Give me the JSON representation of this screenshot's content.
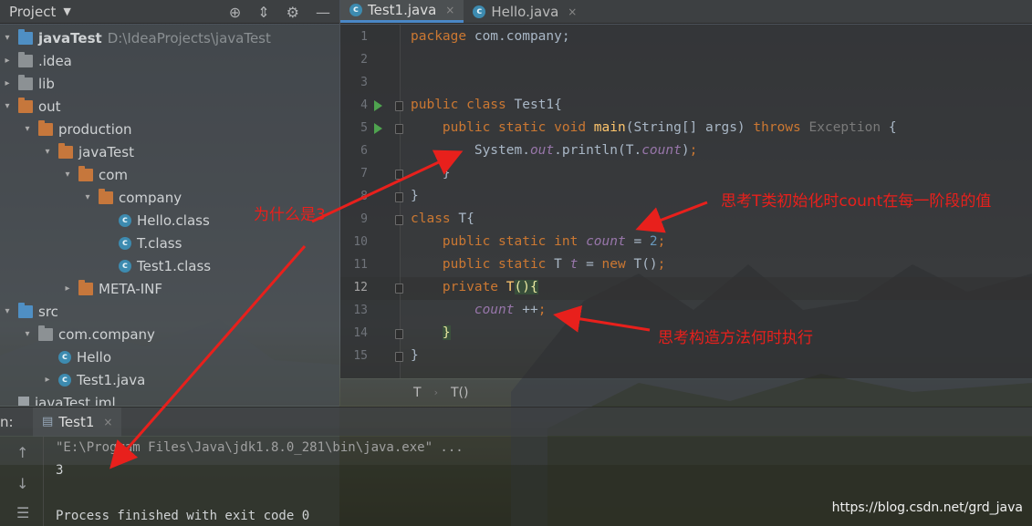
{
  "project_panel": {
    "title": "Project",
    "tree": [
      {
        "label": "javaTest",
        "hint": "D:\\IdeaProjects\\javaTest",
        "kind": "folder-blue",
        "arrow": "▾",
        "depth": 0,
        "bold": true
      },
      {
        "label": ".idea",
        "kind": "folder",
        "arrow": "▸",
        "depth": 0
      },
      {
        "label": "lib",
        "kind": "folder",
        "arrow": "▸",
        "depth": 0
      },
      {
        "label": "out",
        "kind": "folder-orange",
        "arrow": "▾",
        "depth": 0
      },
      {
        "label": "production",
        "kind": "folder-orange",
        "arrow": "▾",
        "depth": 1
      },
      {
        "label": "javaTest",
        "kind": "folder-orange",
        "arrow": "▾",
        "depth": 2
      },
      {
        "label": "com",
        "kind": "folder-orange",
        "arrow": "▾",
        "depth": 3
      },
      {
        "label": "company",
        "kind": "folder-orange",
        "arrow": "▾",
        "depth": 4
      },
      {
        "label": "Hello.class",
        "kind": "class",
        "arrow": "",
        "depth": 5
      },
      {
        "label": "T.class",
        "kind": "class",
        "arrow": "",
        "depth": 5
      },
      {
        "label": "Test1.class",
        "kind": "class",
        "arrow": "",
        "depth": 5
      },
      {
        "label": "META-INF",
        "kind": "folder-orange",
        "arrow": "▸",
        "depth": 3
      },
      {
        "label": "src",
        "kind": "folder-blue",
        "arrow": "▾",
        "depth": 0
      },
      {
        "label": "com.company",
        "kind": "folder",
        "arrow": "▾",
        "depth": 1
      },
      {
        "label": "Hello",
        "kind": "class",
        "arrow": "",
        "depth": 2
      },
      {
        "label": "Test1.java",
        "kind": "class",
        "arrow": "▸",
        "depth": 2
      },
      {
        "label": "javaTest.iml",
        "kind": "file",
        "arrow": "",
        "depth": 0
      }
    ]
  },
  "editor": {
    "tabs": [
      {
        "label": "Test1.java",
        "active": true
      },
      {
        "label": "Hello.java",
        "active": false
      }
    ],
    "lines": [
      {
        "n": "1",
        "tokens": [
          [
            "kw",
            "package "
          ],
          [
            "",
            "com.company;"
          ]
        ]
      },
      {
        "n": "2",
        "tokens": []
      },
      {
        "n": "3",
        "tokens": []
      },
      {
        "n": "4",
        "tokens": [
          [
            "kw",
            "public class "
          ],
          [
            "",
            "Test1{"
          ]
        ],
        "run": true
      },
      {
        "n": "5",
        "tokens": [
          [
            "",
            "    "
          ],
          [
            "kw",
            "public static void "
          ],
          [
            "fn",
            "main"
          ],
          [
            "",
            "(String[] args) "
          ],
          [
            "kw",
            "throws "
          ],
          [
            "dim",
            "Exception "
          ],
          [
            "",
            "{"
          ]
        ],
        "run": true
      },
      {
        "n": "6",
        "tokens": [
          [
            "",
            "        System."
          ],
          [
            "st",
            "out"
          ],
          [
            "",
            ".println(T."
          ],
          [
            "st",
            "count"
          ],
          [
            "",
            ")"
          ],
          [
            "kw",
            ";"
          ]
        ]
      },
      {
        "n": "7",
        "tokens": [
          [
            "",
            "    }"
          ]
        ]
      },
      {
        "n": "8",
        "tokens": [
          [
            "",
            "}"
          ]
        ]
      },
      {
        "n": "9",
        "tokens": [
          [
            "kw",
            "class "
          ],
          [
            "",
            "T{"
          ]
        ]
      },
      {
        "n": "10",
        "tokens": [
          [
            "",
            "    "
          ],
          [
            "kw",
            "public static int "
          ],
          [
            "st",
            "count"
          ],
          [
            "",
            " = "
          ],
          [
            "num",
            "2"
          ],
          [
            "kw",
            ";"
          ]
        ]
      },
      {
        "n": "11",
        "tokens": [
          [
            "",
            "    "
          ],
          [
            "kw",
            "public static "
          ],
          [
            "",
            "T "
          ],
          [
            "st",
            "t"
          ],
          [
            "",
            " = "
          ],
          [
            "kw",
            "new "
          ],
          [
            "",
            "T()"
          ],
          [
            "kw",
            ";"
          ]
        ]
      },
      {
        "n": "12",
        "tokens": [
          [
            "",
            "    "
          ],
          [
            "kw",
            "private "
          ],
          [
            "fn",
            "T"
          ],
          [
            "paren",
            "()"
          ],
          [
            "paren",
            "{"
          ]
        ],
        "current": true
      },
      {
        "n": "13",
        "tokens": [
          [
            "",
            "        "
          ],
          [
            "st",
            "count"
          ],
          [
            "",
            " ++"
          ],
          [
            "kw",
            ";"
          ]
        ]
      },
      {
        "n": "14",
        "tokens": [
          [
            "",
            "    "
          ],
          [
            "paren",
            "}"
          ]
        ]
      },
      {
        "n": "15",
        "tokens": [
          [
            "",
            "}"
          ]
        ]
      }
    ],
    "breadcrumb": [
      "T",
      "T()"
    ]
  },
  "run_panel": {
    "label": "n:",
    "tab": "Test1",
    "output": [
      "\"E:\\Program Files\\Java\\jdk1.8.0_281\\bin\\java.exe\" ...",
      "3",
      "",
      "Process finished with exit code 0"
    ]
  },
  "annotations": {
    "why": "为什么是3",
    "think_init": "思考T类初始化时count在每一阶段的值",
    "think_ctor": "思考构造方法何时执行"
  },
  "watermark": "https://blog.csdn.net/grd_java",
  "colors": {
    "annotation": "#e8201c",
    "keyword": "#cc7832",
    "static_field": "#9876aa",
    "method": "#ffc66d",
    "number": "#6897bb"
  }
}
